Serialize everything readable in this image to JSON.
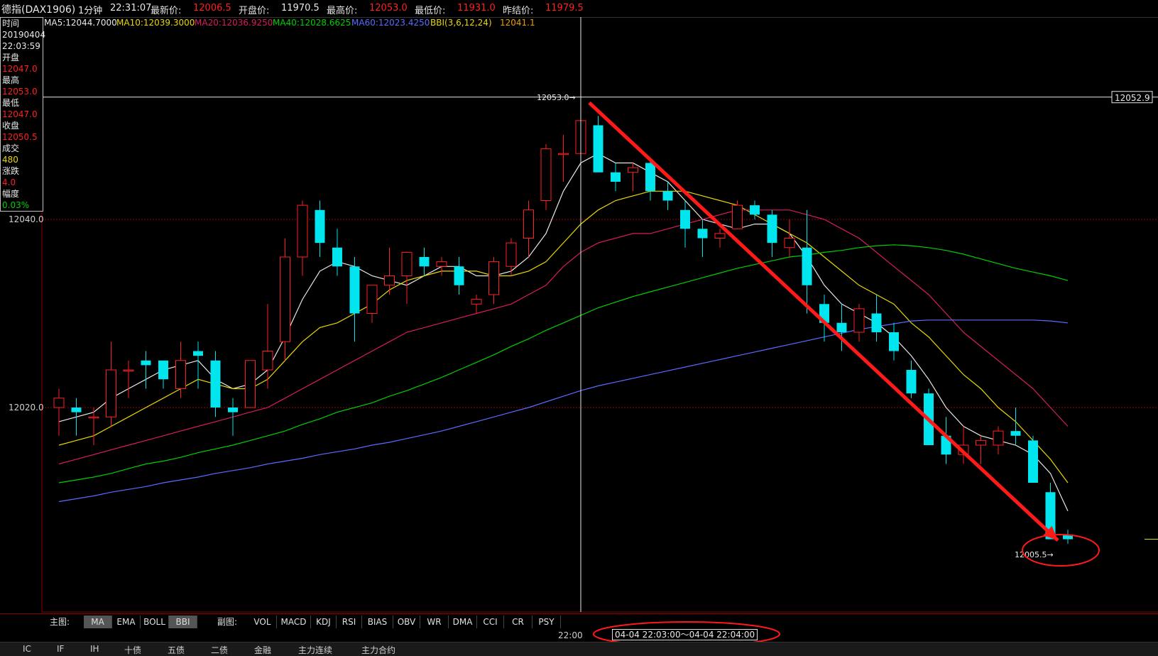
{
  "header": {
    "symbol": "德指(DAX1906)",
    "period": "1分钟",
    "clock": "22:31:07",
    "latest_label": "最新价:",
    "latest": "12006.5",
    "open_label": "开盘价:",
    "open": "11970.5",
    "high_label": "最高价:",
    "high": "12053.0",
    "low_label": "最低价:",
    "low": "11931.0",
    "prev_label": "昨结价:",
    "prev": "11979.5"
  },
  "legend": [
    {
      "text": "MA5:12044.7000",
      "color": "#e8e8e8"
    },
    {
      "text": "MA10:12039.3000",
      "color": "#e8d800"
    },
    {
      "text": "MA20:12036.9250",
      "color": "#d81b60"
    },
    {
      "text": "MA40:12028.6625",
      "color": "#00d000"
    },
    {
      "text": "MA60:12023.4250",
      "color": "#5a6cff"
    },
    {
      "text": "BBI(3,6,12,24)",
      "color": "#e8d800"
    },
    {
      "text": "12041.1",
      "color": "#e8a000"
    }
  ],
  "info": {
    "time_label": "时间",
    "date": "20190404",
    "time": "22:03:59",
    "open_label": "开盘",
    "open": "12047.0",
    "high_label": "最高",
    "high": "12053.0",
    "low_label": "最低",
    "low": "12047.0",
    "close_label": "收盘",
    "close": "12050.5",
    "vol_label": "成交",
    "vol": "480",
    "chg_label": "涨跌",
    "chg": "4.0",
    "amp_label": "幅度",
    "amp": "0.03%"
  },
  "axis": {
    "price_label_1": "12040.0",
    "price_label_2": "12020.0",
    "cursor_price": "12052.9",
    "time_label": "22:00"
  },
  "annotations": {
    "max_label": "12053.0",
    "min_label": "12005.5",
    "time_range": "04-04  22:03:00〜04-04 22:04:00"
  },
  "colors": {
    "up": "#ff2020",
    "down": "#00e5ee",
    "arrow": "#ff1a1a",
    "grid": "#8b0000"
  },
  "chart_data": {
    "type": "candlestick",
    "price_min": 12000,
    "price_max": 12060,
    "reference_prices": [
      12040,
      12020
    ],
    "candles": [
      {
        "o": 12020,
        "h": 12022,
        "l": 12017,
        "c": 12021
      },
      {
        "o": 12020,
        "h": 12021,
        "l": 12017,
        "c": 12019.5
      },
      {
        "o": 12019,
        "h": 12020,
        "l": 12016,
        "c": 12019
      },
      {
        "o": 12019,
        "h": 12027,
        "l": 12018,
        "c": 12024
      },
      {
        "o": 12024,
        "h": 12025,
        "l": 12021,
        "c": 12024
      },
      {
        "o": 12025,
        "h": 12026,
        "l": 12022,
        "c": 12024.5
      },
      {
        "o": 12025,
        "h": 12025,
        "l": 12022,
        "c": 12023
      },
      {
        "o": 12022,
        "h": 12027,
        "l": 12021,
        "c": 12025
      },
      {
        "o": 12026,
        "h": 12027,
        "l": 12022,
        "c": 12025.5
      },
      {
        "o": 12025,
        "h": 12026,
        "l": 12019,
        "c": 12020
      },
      {
        "o": 12020,
        "h": 12021,
        "l": 12017,
        "c": 12019.5
      },
      {
        "o": 12020,
        "h": 12025,
        "l": 12020,
        "c": 12025
      },
      {
        "o": 12024,
        "h": 12031,
        "l": 12022,
        "c": 12026
      },
      {
        "o": 12027,
        "h": 12038,
        "l": 12025,
        "c": 12036
      },
      {
        "o": 12036,
        "h": 12042,
        "l": 12034,
        "c": 12041.5
      },
      {
        "o": 12041,
        "h": 12042,
        "l": 12036,
        "c": 12037.5
      },
      {
        "o": 12037,
        "h": 12039,
        "l": 12034,
        "c": 12035
      },
      {
        "o": 12035,
        "h": 12036,
        "l": 12027,
        "c": 12030
      },
      {
        "o": 12030,
        "h": 12033,
        "l": 12029,
        "c": 12033
      },
      {
        "o": 12033,
        "h": 12037,
        "l": 12032,
        "c": 12034
      },
      {
        "o": 12034,
        "h": 12036,
        "l": 12031,
        "c": 12036.5
      },
      {
        "o": 12036,
        "h": 12037,
        "l": 12034,
        "c": 12035
      },
      {
        "o": 12035,
        "h": 12036,
        "l": 12034,
        "c": 12035.5
      },
      {
        "o": 12035,
        "h": 12036,
        "l": 12032,
        "c": 12033
      },
      {
        "o": 12031,
        "h": 12032,
        "l": 12030,
        "c": 12031.5
      },
      {
        "o": 12032,
        "h": 12036,
        "l": 12031,
        "c": 12035.5
      },
      {
        "o": 12035,
        "h": 12038,
        "l": 12034,
        "c": 12037.5
      },
      {
        "o": 12038,
        "h": 12042,
        "l": 12036,
        "c": 12041
      },
      {
        "o": 12042,
        "h": 12048,
        "l": 12041,
        "c": 12047.5
      },
      {
        "o": 12047,
        "h": 12049,
        "l": 12044,
        "c": 12047
      },
      {
        "o": 12047,
        "h": 12053,
        "l": 12047,
        "c": 12050.5
      },
      {
        "o": 12050,
        "h": 12051,
        "l": 12045,
        "c": 12045
      },
      {
        "o": 12045,
        "h": 12046,
        "l": 12043,
        "c": 12044
      },
      {
        "o": 12045,
        "h": 12046,
        "l": 12043,
        "c": 12045.5
      },
      {
        "o": 12046,
        "h": 12046.5,
        "l": 12042,
        "c": 12043
      },
      {
        "o": 12043,
        "h": 12044,
        "l": 12041,
        "c": 12042
      },
      {
        "o": 12041,
        "h": 12042,
        "l": 12037,
        "c": 12039
      },
      {
        "o": 12039,
        "h": 12040,
        "l": 12036,
        "c": 12038
      },
      {
        "o": 12038,
        "h": 12039,
        "l": 12037,
        "c": 12038.5
      },
      {
        "o": 12039,
        "h": 12042,
        "l": 12039,
        "c": 12041.5
      },
      {
        "o": 12041.5,
        "h": 12042,
        "l": 12040,
        "c": 12040.5
      },
      {
        "o": 12040.5,
        "h": 12041,
        "l": 12036,
        "c": 12037.5
      },
      {
        "o": 12037,
        "h": 12040,
        "l": 12036,
        "c": 12038
      },
      {
        "o": 12037,
        "h": 12041,
        "l": 12030,
        "c": 12033
      },
      {
        "o": 12031,
        "h": 12032,
        "l": 12027,
        "c": 12029
      },
      {
        "o": 12029,
        "h": 12031,
        "l": 12026,
        "c": 12028
      },
      {
        "o": 12028,
        "h": 12031,
        "l": 12027,
        "c": 12030.5
      },
      {
        "o": 12030,
        "h": 12032,
        "l": 12027,
        "c": 12028
      },
      {
        "o": 12028,
        "h": 12029,
        "l": 12025,
        "c": 12026
      },
      {
        "o": 12024,
        "h": 12025,
        "l": 12021,
        "c": 12021.5
      },
      {
        "o": 12021.5,
        "h": 12022,
        "l": 12016,
        "c": 12016
      },
      {
        "o": 12017,
        "h": 12019,
        "l": 12014,
        "c": 12015
      },
      {
        "o": 12015,
        "h": 12018,
        "l": 12014,
        "c": 12016
      },
      {
        "o": 12016,
        "h": 12017,
        "l": 12014,
        "c": 12016.5
      },
      {
        "o": 12016,
        "h": 12018,
        "l": 12015,
        "c": 12017.5
      },
      {
        "o": 12017.5,
        "h": 12020,
        "l": 12016,
        "c": 12017
      },
      {
        "o": 12016.5,
        "h": 12017,
        "l": 12012,
        "c": 12012
      },
      {
        "o": 12011,
        "h": 12012,
        "l": 12006,
        "c": 12006
      },
      {
        "o": 12006.5,
        "h": 12007,
        "l": 12005.5,
        "c": 12006
      }
    ],
    "ma_series": [
      {
        "name": "MA5",
        "color": "#e8e8e8",
        "values": [
          12018.5,
          12019,
          12019.5,
          12021,
          12022,
          12023,
          12024,
          12024.5,
          12025,
          12023,
          12022,
          12022.5,
          12024,
          12027.5,
          12031.5,
          12034.5,
          12035.5,
          12035,
          12034,
          12033.5,
          12033,
          12034,
          12035,
          12035,
          12034,
          12034,
          12034.5,
          12036,
          12038.5,
          12043,
          12046,
          12047,
          12046,
          12046,
          12045,
          12044,
          12042,
          12040,
          12039.5,
          12039,
          12039.5,
          12039.5,
          12038.5,
          12036,
          12033,
          12031,
          12030,
          12029,
          12027.5,
          12025.5,
          12023,
          12020,
          12018,
          12017,
          12016.5,
          12016,
          12015,
          12013,
          12009
        ]
      },
      {
        "name": "MA10",
        "color": "#e8d800",
        "values": [
          12016,
          12016.5,
          12017,
          12018,
          12019,
          12020,
          12021,
          12022,
          12023,
          12022.5,
          12022,
          12022,
          12023,
          12025,
          12027,
          12028.5,
          12029,
          12030,
          12031,
          12032.5,
          12033.5,
          12034,
          12034.5,
          12034.5,
          12034.5,
          12034,
          12034,
          12034.5,
          12035.5,
          12037.5,
          12039.5,
          12041,
          12042,
          12042.5,
          12043,
          12043,
          12043,
          12042.5,
          12042,
          12041.5,
          12040.5,
          12039.5,
          12038.5,
          12037.5,
          12036,
          12034.5,
          12033,
          12032,
          12031,
          12029,
          12027.5,
          12025.5,
          12023.5,
          12022,
          12020,
          12018.5,
          12016.5,
          12014.5,
          12012
        ]
      },
      {
        "name": "MA20",
        "color": "#d81b60",
        "values": [
          12014,
          12014.5,
          12015,
          12015.5,
          12016,
          12016.5,
          12017,
          12017.5,
          12018,
          12018.5,
          12019,
          12019.5,
          12020,
          12021,
          12022,
          12023,
          12024,
          12025,
          12026,
          12027,
          12028,
          12028.5,
          12029,
          12029.5,
          12030,
          12030.5,
          12031,
          12032,
          12033,
          12035,
          12036.5,
          12037.5,
          12038,
          12038.5,
          12038.5,
          12039,
          12039.5,
          12040,
          12040.5,
          12041,
          12041,
          12041,
          12041,
          12040.5,
          12040,
          12039,
          12038,
          12036.5,
          12035,
          12033.5,
          12032,
          12030,
          12028,
          12026.5,
          12025,
          12023.5,
          12022,
          12020,
          12018
        ]
      },
      {
        "name": "MA40",
        "color": "#00d000",
        "values": [
          12012,
          12012.3,
          12012.6,
          12013,
          12013.5,
          12014,
          12014.3,
          12014.7,
          12015.2,
          12015.6,
          12016,
          12016.5,
          12017,
          12017.5,
          12018.2,
          12018.8,
          12019.5,
          12020,
          12020.5,
          12021.2,
          12021.8,
          12022.5,
          12023.2,
          12024,
          12024.8,
          12025.6,
          12026.5,
          12027.3,
          12028.2,
          12029,
          12029.8,
          12030.6,
          12031.2,
          12031.8,
          12032.3,
          12032.8,
          12033.3,
          12033.8,
          12034.3,
          12034.8,
          12035.2,
          12035.6,
          12036,
          12036.2,
          12036.5,
          12036.7,
          12037,
          12037.2,
          12037.3,
          12037.2,
          12037,
          12036.7,
          12036.3,
          12035.8,
          12035.3,
          12034.8,
          12034.4,
          12034,
          12033.5
        ]
      },
      {
        "name": "MA60",
        "color": "#5a6cff",
        "values": [
          12010,
          12010.3,
          12010.6,
          12011,
          12011.3,
          12011.6,
          12012,
          12012.3,
          12012.6,
          12013,
          12013.3,
          12013.6,
          12014,
          12014.3,
          12014.6,
          12015,
          12015.3,
          12015.6,
          12016,
          12016.3,
          12016.7,
          12017.1,
          12017.5,
          12018,
          12018.5,
          12019,
          12019.5,
          12020,
          12020.6,
          12021.2,
          12021.8,
          12022.3,
          12022.7,
          12023.1,
          12023.5,
          12023.9,
          12024.3,
          12024.7,
          12025.1,
          12025.5,
          12025.9,
          12026.3,
          12026.7,
          12027.1,
          12027.5,
          12027.9,
          12028.3,
          12028.6,
          12028.9,
          12029.2,
          12029.3,
          12029.3,
          12029.3,
          12029.3,
          12029.3,
          12029.3,
          12029.3,
          12029.2,
          12029
        ]
      }
    ]
  },
  "indicator_bar": {
    "main_label": "主图:",
    "main_tabs": [
      "MA",
      "EMA",
      "BOLL",
      "BBI"
    ],
    "sub_label": "副图:",
    "sub_tabs": [
      "VOL",
      "MACD",
      "KDJ",
      "RSI",
      "BIAS",
      "OBV",
      "WR",
      "DMA",
      "CCI",
      "CR",
      "PSY"
    ]
  },
  "bottom_tabs": [
    "IC",
    "IF",
    "IH",
    "十债",
    "五债",
    "二债",
    "金融",
    "主力连续",
    "主力合约"
  ]
}
